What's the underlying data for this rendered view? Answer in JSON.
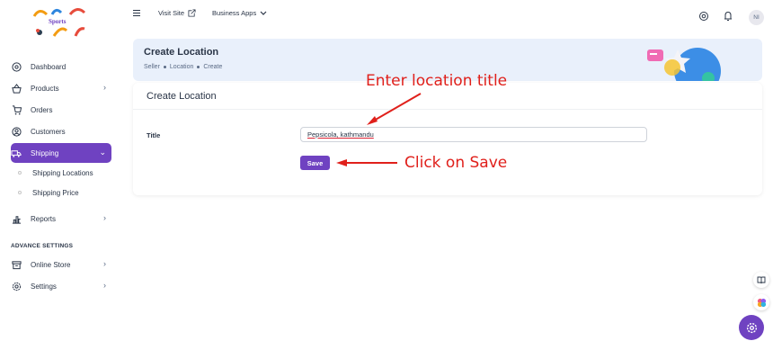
{
  "brand": {
    "logo_text": "Sports"
  },
  "sidebar": {
    "items": [
      {
        "label": "Dashboard"
      },
      {
        "label": "Products"
      },
      {
        "label": "Orders"
      },
      {
        "label": "Customers"
      },
      {
        "label": "Shipping"
      },
      {
        "label": "Reports"
      }
    ],
    "shipping_sub": [
      {
        "label": "Shipping Locations"
      },
      {
        "label": "Shipping Price"
      }
    ],
    "section_label": "ADVANCE SETTINGS",
    "advance_items": [
      {
        "label": "Online Store"
      },
      {
        "label": "Settings"
      }
    ]
  },
  "topbar": {
    "visit_site": "Visit Site",
    "business_apps": "Business Apps",
    "avatar_initials": "NI"
  },
  "header": {
    "title": "Create Location",
    "breadcrumb": [
      "Seller",
      "Location",
      "Create"
    ]
  },
  "form": {
    "title": "Create Location",
    "field_label": "Title",
    "field_value": "Pepsicola, kathmandu",
    "save_label": "Save"
  },
  "annotations": {
    "enter_title": "Enter location title",
    "click_save": "Click on Save"
  },
  "colors": {
    "accent": "#6f42c1",
    "header_bg": "#e9f0fb",
    "annotation": "#e0201b"
  }
}
